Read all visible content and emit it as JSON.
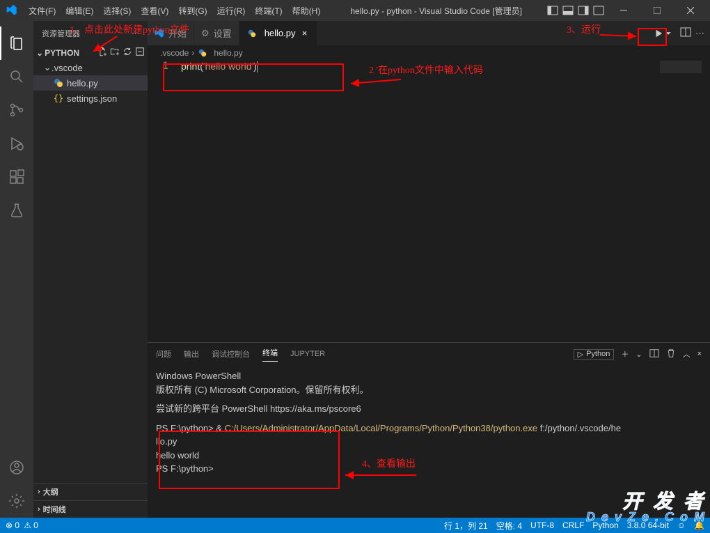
{
  "title": "hello.py - python - Visual Studio Code [管理员]",
  "menu": [
    "文件(F)",
    "编辑(E)",
    "选择(S)",
    "查看(V)",
    "转到(G)",
    "运行(R)",
    "终端(T)",
    "帮助(H)"
  ],
  "sidebar": {
    "title": "资源管理器",
    "folder": "PYTHON",
    "vscode_folder": ".vscode",
    "files": {
      "hello": "hello.py",
      "settings": "settings.json"
    },
    "outline": "大纲",
    "timeline": "时间线"
  },
  "tabs": {
    "start": "开始",
    "settings": "设置",
    "hello": "hello.py"
  },
  "breadcrumb": {
    "a": ".vscode",
    "b": "hello.py"
  },
  "code": {
    "line_no": "1",
    "func": "print",
    "open": "(",
    "str": "'hello world'",
    "close": ")"
  },
  "panel": {
    "tabs": {
      "issues": "问题",
      "output": "输出",
      "debug": "调试控制台",
      "terminal": "终端",
      "jupyter": "JUPYTER"
    },
    "badge": "Python",
    "term": {
      "l1": "Windows PowerShell",
      "l2": "版权所有 (C) Microsoft Corporation。保留所有权利。",
      "l3": "尝试新的跨平台 PowerShell https://aka.ms/pscore6",
      "l4a": "PS F:\\python> & ",
      "l4b": "C:/Users/Administrator/AppData/Local/Programs/Python/Python38/python.exe",
      "l4c": " f:/python/.vscode/he",
      "l5": "llo.py",
      "l6": "hello world",
      "l7": "PS F:\\python>"
    }
  },
  "status": {
    "left1": "⊗ 0",
    "left2": "⚠ 0",
    "ln": "行 1，列 21",
    "spaces": "空格: 4",
    "enc": "UTF-8",
    "eol": "CRLF",
    "lang": "Python",
    "ver": "3.8.0 64-bit"
  },
  "anno": {
    "a1": "1、点击此处新建python文件",
    "a2": "2 '在python文件中输入代码",
    "a3": "3、运行",
    "a4": "4、查看输出"
  },
  "watermark": {
    "l1": "开 发 者",
    "l2": "D e v Z e . C o M"
  }
}
